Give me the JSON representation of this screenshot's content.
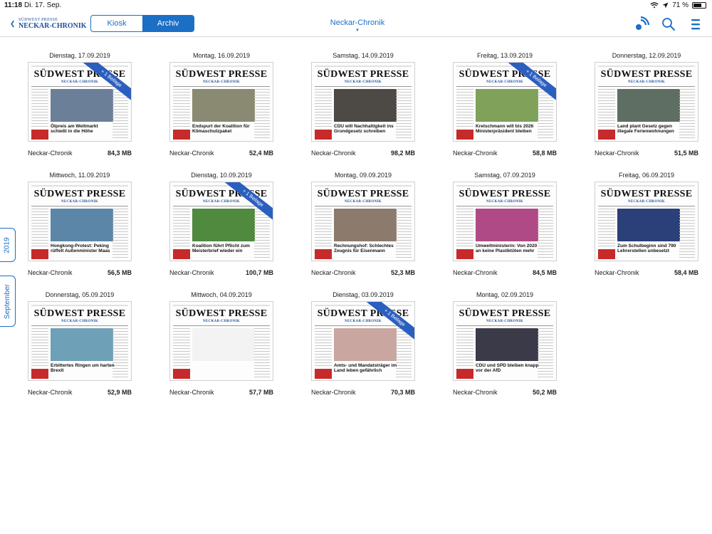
{
  "status_bar": {
    "time": "11:18",
    "date": "Di. 17. Sep.",
    "battery": "71 %",
    "battery_level": 0.71
  },
  "nav": {
    "brand_line1": "SÜDWEST PRESSE",
    "brand_line2": "NECKAR-CHRONIK",
    "tabs": [
      {
        "label": "Kiosk",
        "active": false
      },
      {
        "label": "Archiv",
        "active": true
      }
    ],
    "title": "Neckar-Chronik"
  },
  "side_tabs": {
    "year": "2019",
    "month": "September"
  },
  "cover_texts": {
    "masthead": "SÜDWEST PRESSE",
    "subtitle": "NECKAR-CHRONIK",
    "beilage": "+ 1 Beilage"
  },
  "colors": {
    "accent": "#1b6fc4",
    "ribbon": "#2b5fbf",
    "brand": "#1b4f9c"
  },
  "issues": [
    {
      "date": "Dienstag, 17.09.2019",
      "title": "Neckar-Chronik",
      "size": "84,3 MB",
      "beilage": true,
      "headline": "Ölpreis am Weltmarkt schießt in die Höhe",
      "photo": "#6b7f99"
    },
    {
      "date": "Montag, 16.09.2019",
      "title": "Neckar-Chronik",
      "size": "52,4 MB",
      "beilage": false,
      "headline": "Endspurt der Koalition für Klimaschutzpaket",
      "photo": "#8a8a72"
    },
    {
      "date": "Samstag, 14.09.2019",
      "title": "Neckar-Chronik",
      "size": "98,2 MB",
      "beilage": false,
      "headline": "CDU will Nachhaltigkeit ins Grundgesetz schreiben",
      "photo": "#4d4a45"
    },
    {
      "date": "Freitag, 13.09.2019",
      "title": "Neckar-Chronik",
      "size": "58,8 MB",
      "beilage": true,
      "headline": "Kretschmann will bis 2026 Ministerpräsident bleiben",
      "photo": "#7fa15a"
    },
    {
      "date": "Donnerstag, 12.09.2019",
      "title": "Neckar-Chronik",
      "size": "51,5 MB",
      "beilage": false,
      "headline": "Land plant Gesetz gegen illegale Ferienwohnungen",
      "photo": "#5e6e62"
    },
    {
      "date": "Mittwoch, 11.09.2019",
      "title": "Neckar-Chronik",
      "size": "56,5 MB",
      "beilage": false,
      "headline": "Hongkong-Protest: Peking rüffelt Außenminister Maas",
      "photo": "#5b86a8"
    },
    {
      "date": "Dienstag, 10.09.2019",
      "title": "Neckar-Chronik",
      "size": "100,7 MB",
      "beilage": true,
      "headline": "Koalition führt Pflicht zum Meisterbrief wieder ein",
      "photo": "#4f8a3e"
    },
    {
      "date": "Montag, 09.09.2019",
      "title": "Neckar-Chronik",
      "size": "52,3 MB",
      "beilage": false,
      "headline": "Rechnungshof: Schlechtes Zeugnis für Eisenmann",
      "photo": "#8c7a6c"
    },
    {
      "date": "Samstag, 07.09.2019",
      "title": "Neckar-Chronik",
      "size": "84,5 MB",
      "beilage": false,
      "headline": "Umweltministerin: Von 2020 an keine Plastiktüten mehr",
      "photo": "#b04a86"
    },
    {
      "date": "Freitag, 06.09.2019",
      "title": "Neckar-Chronik",
      "size": "58,4 MB",
      "beilage": false,
      "headline": "Zum Schulbeginn sind 790 Lehrerstellen unbesetzt",
      "photo": "#2b3f78"
    },
    {
      "date": "Donnerstag, 05.09.2019",
      "title": "Neckar-Chronik",
      "size": "52,9 MB",
      "beilage": false,
      "headline": "Erbittertes Ringen um harten Brexit",
      "photo": "#6ea0b8"
    },
    {
      "date": "Mittwoch, 04.09.2019",
      "title": "Neckar-Chronik",
      "size": "57,7 MB",
      "beilage": false,
      "headline": "",
      "photo": "#f3f3f3"
    },
    {
      "date": "Dienstag, 03.09.2019",
      "title": "Neckar-Chronik",
      "size": "70,3 MB",
      "beilage": true,
      "headline": "Amts- und Mandatsträger im Land leben gefährlich",
      "photo": "#c9a6a0"
    },
    {
      "date": "Montag, 02.09.2019",
      "title": "Neckar-Chronik",
      "size": "50,2 MB",
      "beilage": false,
      "headline": "CDU und SPD bleiben knapp vor der AfD",
      "photo": "#3a3a48"
    }
  ]
}
